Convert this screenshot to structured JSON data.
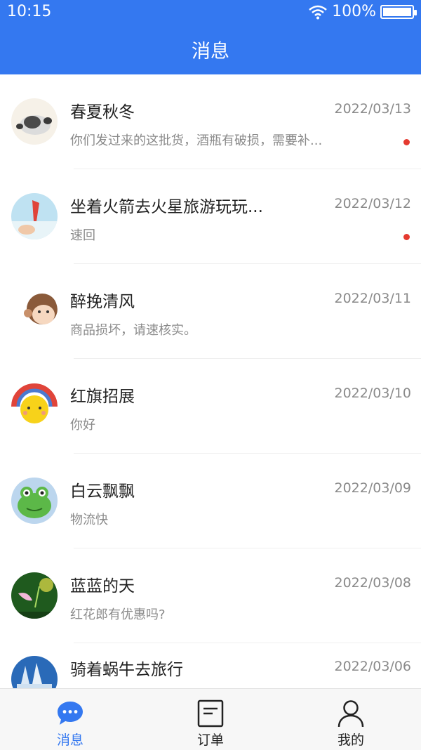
{
  "status": {
    "time": "10:15",
    "battery": "100%"
  },
  "header": {
    "title": "消息"
  },
  "conversations": [
    {
      "name": "春夏秋冬",
      "date": "2022/03/13",
      "message": "你们发过来的这批货，酒瓶有破损，需要补...",
      "unread": true
    },
    {
      "name": "坐着火箭去火星旅游玩玩...",
      "date": "2022/03/12",
      "message": "速回",
      "unread": true
    },
    {
      "name": "醉挽清风",
      "date": "2022/03/11",
      "message": "商品损坏，请速核实。",
      "unread": false
    },
    {
      "name": "红旗招展",
      "date": "2022/03/10",
      "message": "你好",
      "unread": false
    },
    {
      "name": "白云飘飘",
      "date": "2022/03/09",
      "message": "物流快",
      "unread": false
    },
    {
      "name": "蓝蓝的天",
      "date": "2022/03/08",
      "message": "红花郎有优惠吗?",
      "unread": false
    },
    {
      "name": "骑着蜗牛去旅行",
      "date": "2022/03/06",
      "message": "",
      "unread": false
    }
  ],
  "tabs": [
    {
      "label": "消息",
      "icon": "chat-bubble-icon",
      "active": true
    },
    {
      "label": "订单",
      "icon": "order-document-icon",
      "active": false
    },
    {
      "label": "我的",
      "icon": "user-profile-icon",
      "active": false
    }
  ],
  "colors": {
    "primary": "#3478f0",
    "unread_dot": "#e53a30",
    "secondary_text": "#8a8a8a"
  }
}
